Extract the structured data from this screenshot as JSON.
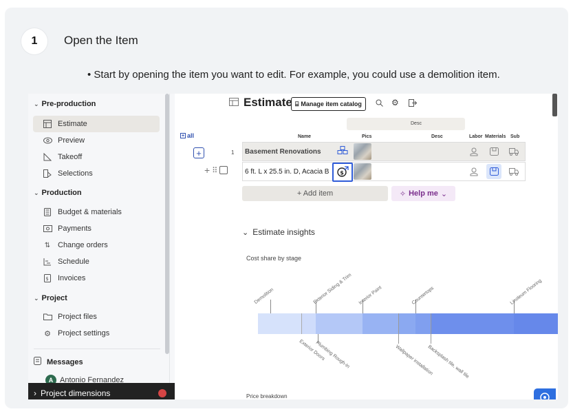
{
  "step": {
    "number": "1",
    "title": "Open the Item",
    "bullet": "• Start by opening the item you want to edit. For example, you could use a demolition item."
  },
  "sidebar": {
    "groups": {
      "preproduction": "Pre-production",
      "production": "Production",
      "project": "Project"
    },
    "preproduction_items": [
      {
        "label": "Estimate",
        "icon": "table-icon"
      },
      {
        "label": "Preview",
        "icon": "eye-icon"
      },
      {
        "label": "Takeoff",
        "icon": "takeoff-icon"
      },
      {
        "label": "Selections",
        "icon": "selections-icon"
      }
    ],
    "production_items": [
      {
        "label": "Budget & materials",
        "icon": "calculator-icon"
      },
      {
        "label": "Payments",
        "icon": "payments-icon"
      },
      {
        "label": "Change orders",
        "icon": "change-orders-icon"
      },
      {
        "label": "Schedule",
        "icon": "schedule-icon"
      },
      {
        "label": "Invoices",
        "icon": "invoice-icon"
      }
    ],
    "project_items": [
      {
        "label": "Project files",
        "icon": "folder-icon"
      },
      {
        "label": "Project settings",
        "icon": "gear-icon"
      }
    ],
    "messages": "Messages",
    "user_name": "Antonio Fernandez",
    "user_initial": "A",
    "project_dimensions": "Project dimensions"
  },
  "estimate": {
    "title": "Estimate",
    "manage_catalog": "Manage item catalog",
    "all_label": "all",
    "desc_header": "Desc",
    "columns": {
      "name": "Name",
      "pics": "Pics",
      "desc": "Desc",
      "labor": "Labor",
      "materials": "Materials",
      "sub": "Sub"
    },
    "rows": [
      {
        "number": "1",
        "name": "Basement Renovations"
      },
      {
        "name": "6 ft. L x 25.5 in. D, Acacia B"
      }
    ],
    "add_item": "+ Add item",
    "help_me": "Help me"
  },
  "insights": {
    "title": "Estimate insights",
    "cost_share_title": "Cost share by stage",
    "stages_top": [
      "Demolition",
      "Exterior Siding & Trim",
      "Interior Paint",
      "Countertops",
      "Linoleum Flooring"
    ],
    "stages_bottom": [
      "Exterior Doors",
      "Plumbing Rough-In",
      "Wallpaper installation",
      "Backsplash tile, wall tile"
    ],
    "price_breakdown": "Price breakdown"
  }
}
